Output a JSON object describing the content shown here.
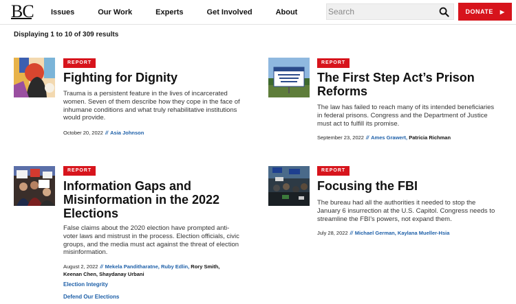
{
  "header": {
    "logo": "BC",
    "nav": [
      "Issues",
      "Our Work",
      "Experts",
      "Get Involved",
      "About"
    ],
    "search_placeholder": "Search",
    "donate_label": "DONATE",
    "donate_arrow": "▶"
  },
  "results_text": "Displaying 1 to 10 of 309 results",
  "cards": [
    {
      "badge": "REPORT",
      "title_lines": [
        "Fighting for Dignity"
      ],
      "desc_lines": [
        "Trauma is a persistent feature in the lives of incarcerated",
        "women. Seven of them describe how they cope in the face of",
        "inhumane conditions and what truly rehabilitative institutions",
        "would provide."
      ],
      "date": "October 20, 2022",
      "sep": "//",
      "authors": [
        "Asia Johnson"
      ]
    },
    {
      "badge": "REPORT",
      "title_lines": [
        "The First Step Act’s Prison",
        "Reforms"
      ],
      "desc_lines": [
        "The law has failed to reach many of its intended beneficiaries",
        "in federal prisons. Congress and the Department of Justice",
        "must act to fulfill its promise."
      ],
      "date": "September 23, 2022",
      "sep": "//",
      "authors": [
        "Ames Grawert,",
        "Patricia Richman"
      ]
    },
    {
      "badge": "REPORT",
      "title_lines": [
        "Information Gaps and",
        "Misinformation in the 2022",
        "Elections"
      ],
      "desc_lines": [
        "False claims about the 2020 election have prompted anti-",
        "voter laws and mistrust in the process. Election officials, civic",
        "groups, and the media must act against the threat of election",
        "misinformation."
      ],
      "date": "August 2, 2022",
      "sep": "//",
      "authors": [
        "Mekela Panditharatne,",
        "Ruby Edlin,",
        "Rory Smith,",
        "Keenan Chen,",
        "Shaydanay Urbani"
      ],
      "tags": [
        "Election Integrity",
        "Defend Our Elections"
      ]
    },
    {
      "badge": "REPORT",
      "title_lines": [
        "Focusing the FBI"
      ],
      "desc_lines": [
        "The bureau had all the authorities it needed to stop the",
        "January 6 insurrection at the U.S. Capitol. Congress needs to",
        "streamline the FBI’s powers, not expand them."
      ],
      "date": "July 28, 2022",
      "sep": "//",
      "authors": [
        "Michael German,",
        "Kaylana Mueller-Hsia"
      ]
    }
  ],
  "colors": {
    "accent_red": "#d7141c",
    "link_blue": "#1d5fa8"
  },
  "icons": [
    "search-icon",
    "play-arrow-icon"
  ]
}
